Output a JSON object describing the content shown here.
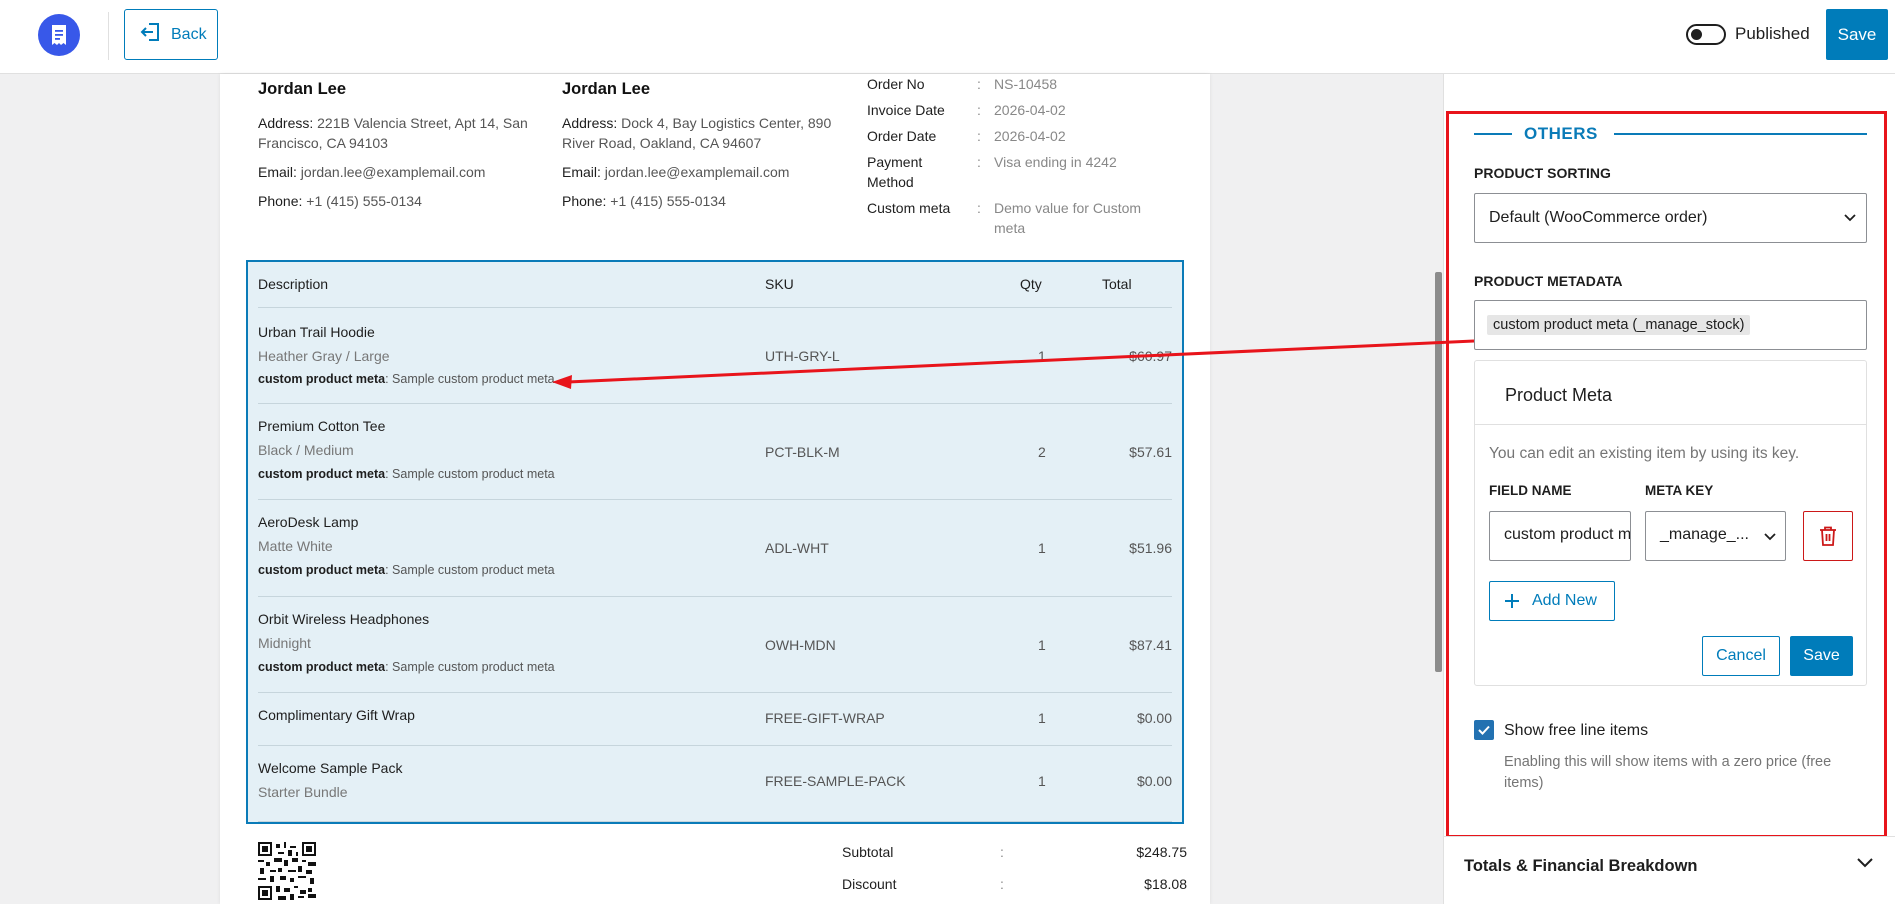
{
  "topbar": {
    "back_label": "Back",
    "published_label": "Published",
    "save_label": "Save"
  },
  "invoice": {
    "billing": {
      "name": "Jordan Lee",
      "address_label": "Address:",
      "address": "221B Valencia Street, Apt 14, San Francisco, CA 94103",
      "email_label": "Email:",
      "email": "jordan.lee@examplemail.com",
      "phone_label": "Phone:",
      "phone": "+1 (415) 555-0134"
    },
    "shipping": {
      "name": "Jordan Lee",
      "address_label": "Address:",
      "address": "Dock 4, Bay Logistics Center, 890 River Road, Oakland, CA 94607",
      "email_label": "Email:",
      "email": "jordan.lee@examplemail.com",
      "phone_label": "Phone:",
      "phone": "+1 (415) 555-0134"
    },
    "order_meta": [
      {
        "key": "Order No",
        "value": "NS-10458"
      },
      {
        "key": "Invoice Date",
        "value": "2026-04-02"
      },
      {
        "key": "Order Date",
        "value": "2026-04-02"
      },
      {
        "key": "Payment Method",
        "value": "Visa ending in 4242"
      },
      {
        "key": "Custom meta",
        "value": "Demo value for Custom meta"
      }
    ],
    "separator": ":",
    "table_headers": {
      "description": "Description",
      "sku": "SKU",
      "qty": "Qty",
      "total": "Total"
    },
    "custom_meta_label": "custom product meta",
    "custom_meta_value": ": Sample custom product meta",
    "items": [
      {
        "title": "Urban Trail Hoodie",
        "variant": "Heather Gray / Large",
        "sku": "UTH-GRY-L",
        "qty": "1",
        "total": "$60.97"
      },
      {
        "title": "Premium Cotton Tee",
        "variant": "Black / Medium",
        "sku": "PCT-BLK-M",
        "qty": "2",
        "total": "$57.61"
      },
      {
        "title": "AeroDesk Lamp",
        "variant": "Matte White",
        "sku": "ADL-WHT",
        "qty": "1",
        "total": "$51.96"
      },
      {
        "title": "Orbit Wireless Headphones",
        "variant": "Midnight",
        "sku": "OWH-MDN",
        "qty": "1",
        "total": "$87.41"
      },
      {
        "title": "Complimentary Gift Wrap",
        "variant": "",
        "sku": "FREE-GIFT-WRAP",
        "qty": "1",
        "total": "$0.00"
      },
      {
        "title": "Welcome Sample Pack",
        "variant": "Starter Bundle",
        "sku": "FREE-SAMPLE-PACK",
        "qty": "1",
        "total": "$0.00"
      }
    ],
    "summary": [
      {
        "key": "Subtotal",
        "value": "$248.75"
      },
      {
        "key": "Discount",
        "value": "$18.08"
      }
    ]
  },
  "sidebar": {
    "section_title": "OTHERS",
    "product_sorting_label": "PRODUCT SORTING",
    "product_sorting_value": "Default (WooCommerce order)",
    "product_metadata_label": "PRODUCT METADATA",
    "product_metadata_tag": "custom product meta (_manage_stock)",
    "product_meta_card": {
      "title": "Product Meta",
      "description": "You can edit an existing item by using its key.",
      "field_name_label": "FIELD NAME",
      "meta_key_label": "META KEY",
      "field_name_value": "custom product meta",
      "meta_key_value": "_manage_...",
      "add_new_label": "Add New",
      "cancel_label": "Cancel",
      "save_label": "Save"
    },
    "show_free_label": "Show free line items",
    "show_free_help": "Enabling this will show items with a zero price (free items)",
    "totals_section_label": "Totals & Financial Breakdown"
  },
  "colors": {
    "accent": "#007cba",
    "highlight_red": "#e8141b",
    "items_bg": "#e4f0f6",
    "logo": "#3858e9"
  },
  "icons": [
    "invoice-logo-icon",
    "back-arrow-icon",
    "chevron-down-icon",
    "trash-icon",
    "plus-icon",
    "check-icon",
    "qr-code"
  ]
}
